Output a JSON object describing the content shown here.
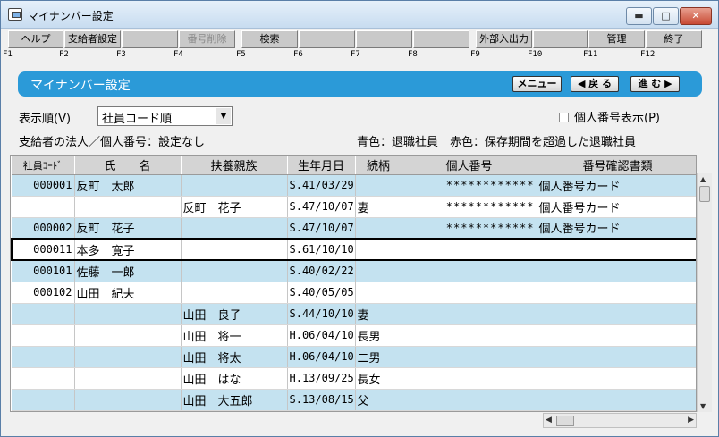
{
  "window": {
    "title": "マイナンバー設定",
    "min_glyph": "▬",
    "max_glyph": "□",
    "close_glyph": "✕"
  },
  "fkeys": [
    {
      "label": "ヘルプ",
      "num": "F1",
      "enabled": true
    },
    {
      "label": "支給者設定",
      "num": "F2",
      "enabled": true
    },
    {
      "label": "",
      "num": "F3",
      "enabled": true
    },
    {
      "label": "番号削除",
      "num": "F4",
      "enabled": false
    },
    {
      "label": "検索",
      "num": "F5",
      "enabled": true
    },
    {
      "label": "",
      "num": "F6",
      "enabled": true
    },
    {
      "label": "",
      "num": "F7",
      "enabled": true
    },
    {
      "label": "",
      "num": "F8",
      "enabled": true
    },
    {
      "label": "外部入出力",
      "num": "F9",
      "enabled": true
    },
    {
      "label": "",
      "num": "F10",
      "enabled": true
    },
    {
      "label": "管理",
      "num": "F11",
      "enabled": true
    },
    {
      "label": "終了",
      "num": "F12",
      "enabled": true
    }
  ],
  "header": {
    "title": "マイナンバー設定",
    "menu_label": "メニュー",
    "back_label": "◀ 戻 る",
    "next_label": "進 む ▶"
  },
  "sort": {
    "label": "表示順(V)",
    "value": "社員コード順"
  },
  "toggle": {
    "label": "個人番号表示(P)",
    "checked": false
  },
  "info": {
    "left": "支給者の法人／個人番号：設定なし",
    "right": "青色：退職社員　赤色：保存期間を超過した退職社員"
  },
  "columns": [
    "社員ｺｰﾄﾞ",
    "氏　　名",
    "扶養親族",
    "生年月日",
    "続柄",
    "個人番号",
    "番号確認書類"
  ],
  "rows": [
    {
      "code": "000001",
      "name": "反町　太郎",
      "dependent": "",
      "dob": "S.41/03/29",
      "relation": "",
      "number": "************",
      "doc": "個人番号カード",
      "band": true
    },
    {
      "code": "",
      "name": "",
      "dependent": "反町　花子",
      "dob": "S.47/10/07",
      "relation": "妻",
      "number": "************",
      "doc": "個人番号カード",
      "band": false
    },
    {
      "code": "000002",
      "name": "反町　花子",
      "dependent": "",
      "dob": "S.47/10/07",
      "relation": "",
      "number": "************",
      "doc": "個人番号カード",
      "band": true
    },
    {
      "code": "000011",
      "name": "本多　寛子",
      "dependent": "",
      "dob": "S.61/10/10",
      "relation": "",
      "number": "",
      "doc": "",
      "band": false,
      "selected": true
    },
    {
      "code": "000101",
      "name": "佐藤　一郎",
      "dependent": "",
      "dob": "S.40/02/22",
      "relation": "",
      "number": "",
      "doc": "",
      "band": true
    },
    {
      "code": "000102",
      "name": "山田　紀夫",
      "dependent": "",
      "dob": "S.40/05/05",
      "relation": "",
      "number": "",
      "doc": "",
      "band": false
    },
    {
      "code": "",
      "name": "",
      "dependent": "山田　良子",
      "dob": "S.44/10/10",
      "relation": "妻",
      "number": "",
      "doc": "",
      "band": true
    },
    {
      "code": "",
      "name": "",
      "dependent": "山田　将一",
      "dob": "H.06/04/10",
      "relation": "長男",
      "number": "",
      "doc": "",
      "band": false
    },
    {
      "code": "",
      "name": "",
      "dependent": "山田　将太",
      "dob": "H.06/04/10",
      "relation": "二男",
      "number": "",
      "doc": "",
      "band": true
    },
    {
      "code": "",
      "name": "",
      "dependent": "山田　はな",
      "dob": "H.13/09/25",
      "relation": "長女",
      "number": "",
      "doc": "",
      "band": false
    },
    {
      "code": "",
      "name": "",
      "dependent": "山田　大五郎",
      "dob": "S.13/08/15",
      "relation": "父",
      "number": "",
      "doc": "",
      "band": true
    },
    {
      "code": "",
      "name": "",
      "dependent": "",
      "dob": "",
      "relation": "",
      "number": "",
      "doc": "",
      "band": false
    }
  ]
}
